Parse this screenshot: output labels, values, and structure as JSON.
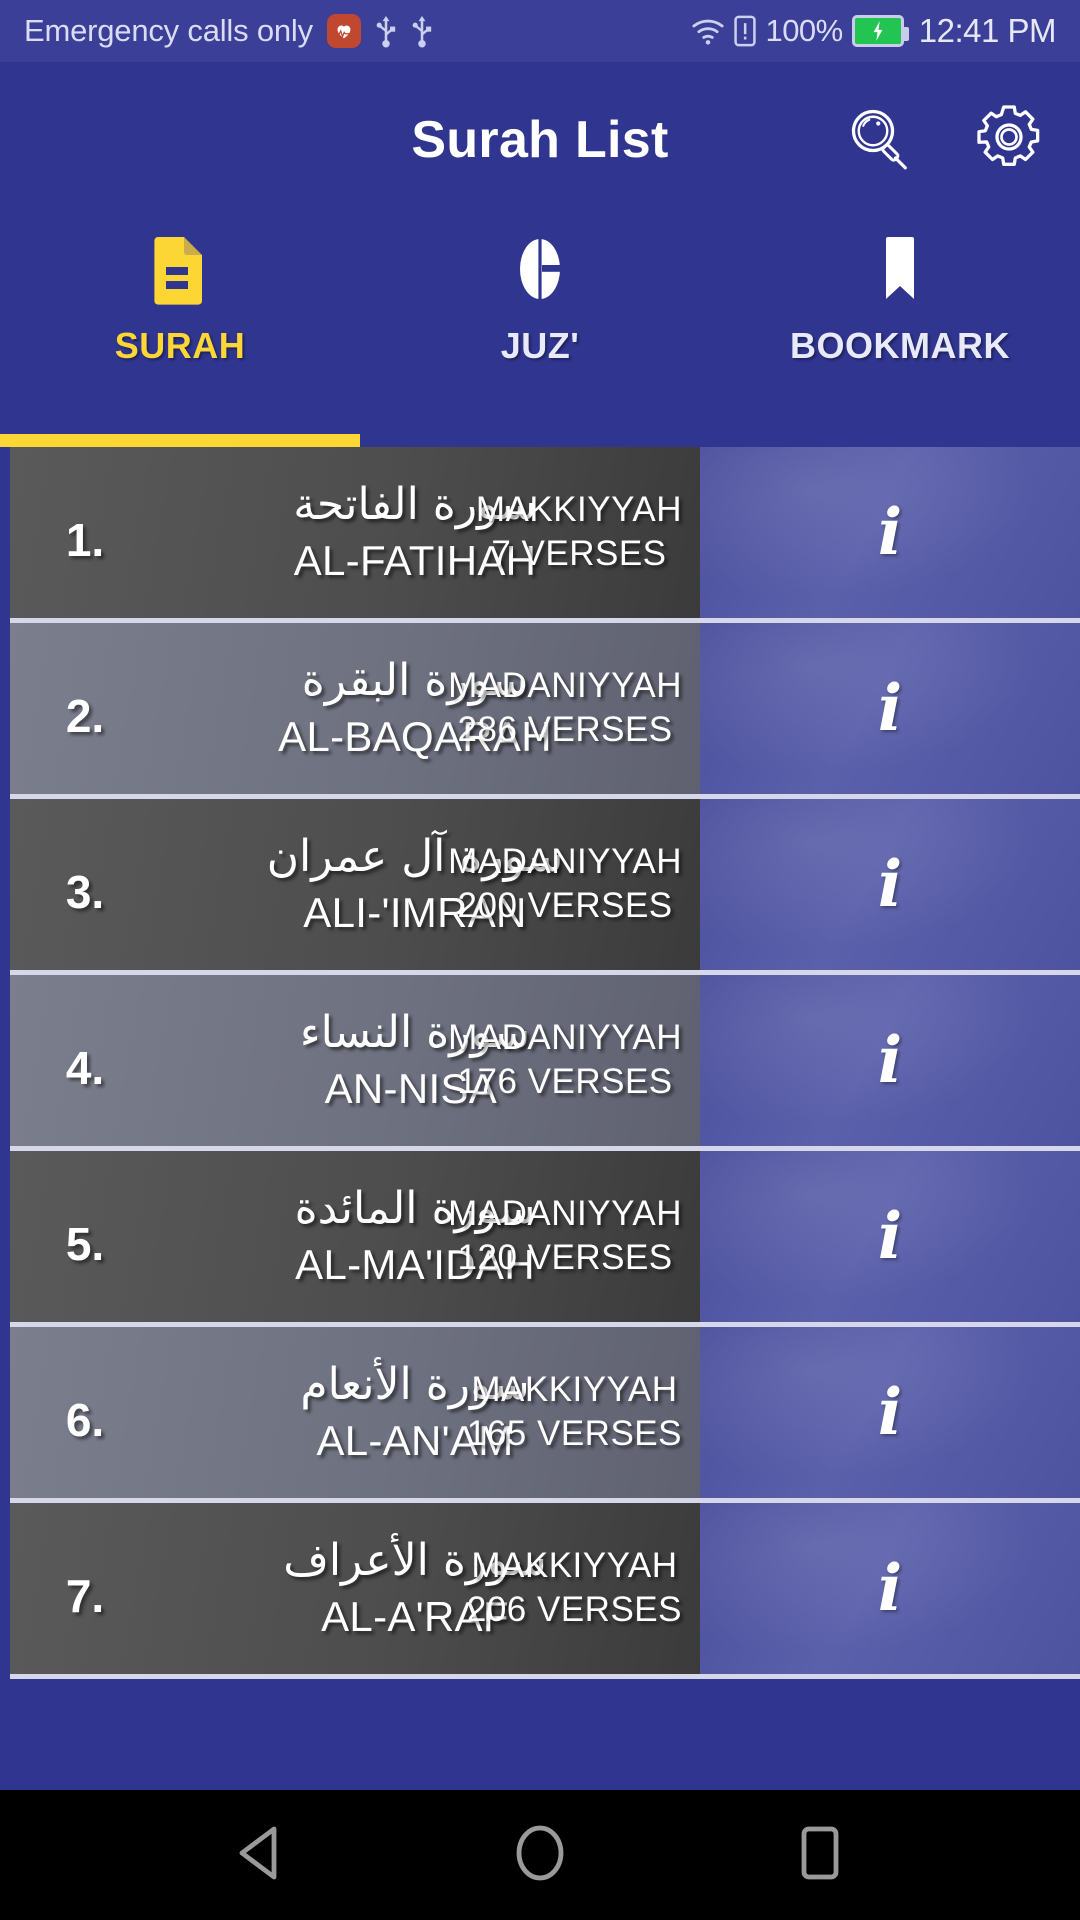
{
  "status_bar": {
    "carrier": "Emergency calls only",
    "health_icon": "heart-rate-icon",
    "usb_icon_1": "usb-icon",
    "usb_icon_2": "usb-icon",
    "wifi_icon": "wifi-icon",
    "sim_icon": "sim-alert-icon",
    "battery_percent": "100%",
    "battery_icon": "battery-charging-icon",
    "time": "12:41 PM"
  },
  "appbar": {
    "title": "Surah List",
    "search_icon": "search-icon",
    "settings_icon": "gear-icon"
  },
  "tabs": {
    "active_index": 0,
    "items": [
      {
        "label": "SURAH",
        "icon": "document-list-icon"
      },
      {
        "label": "JUZ'",
        "icon": "quran-split-icon"
      },
      {
        "label": "BOOKMARK",
        "icon": "bookmark-icon"
      }
    ],
    "indicator_color": "#fcd634"
  },
  "list": {
    "info_glyph": "i",
    "rows": [
      {
        "number": "1.",
        "name_ar": "سورة الفاتحة",
        "name_en": "AL-FATIHAH",
        "revelation": "MAKKIYYAH",
        "verses": "7 VERSES"
      },
      {
        "number": "2.",
        "name_ar": "سورة البقرة",
        "name_en": "AL-BAQARAH",
        "revelation": "MADANIYYAH",
        "verses": "286 VERSES"
      },
      {
        "number": "3.",
        "name_ar": "سورة آل عمران",
        "name_en": "ALI-'IMRAN",
        "revelation": "MADANIYYAH",
        "verses": "200 VERSES"
      },
      {
        "number": "4.",
        "name_ar": "سورة النساء",
        "name_en": "AN-NISA'",
        "revelation": "MADANIYYAH",
        "verses": "176 VERSES"
      },
      {
        "number": "5.",
        "name_ar": "سورة المائدة",
        "name_en": "AL-MA'IDAH",
        "revelation": "MADANIYYAH",
        "verses": "120 VERSES"
      },
      {
        "number": "6.",
        "name_ar": "سورة الأنعام",
        "name_en": "AL-AN'AM",
        "revelation": "MAKKIYYAH",
        "verses": "165 VERSES"
      },
      {
        "number": "7.",
        "name_ar": "سورة الأعراف",
        "name_en": "AL-A'RAF",
        "revelation": "MAKKIYYAH",
        "verses": "206 VERSES"
      }
    ]
  },
  "navbar": {
    "back_icon": "back-triangle-icon",
    "home_icon": "home-circle-icon",
    "recents_icon": "recents-square-icon"
  },
  "colors": {
    "brand_blue": "#30358f",
    "accent_yellow": "#fcd634",
    "row_dark": "#4d4d4d",
    "row_light": "#6e7180",
    "info_panel": "#5b60ab"
  }
}
